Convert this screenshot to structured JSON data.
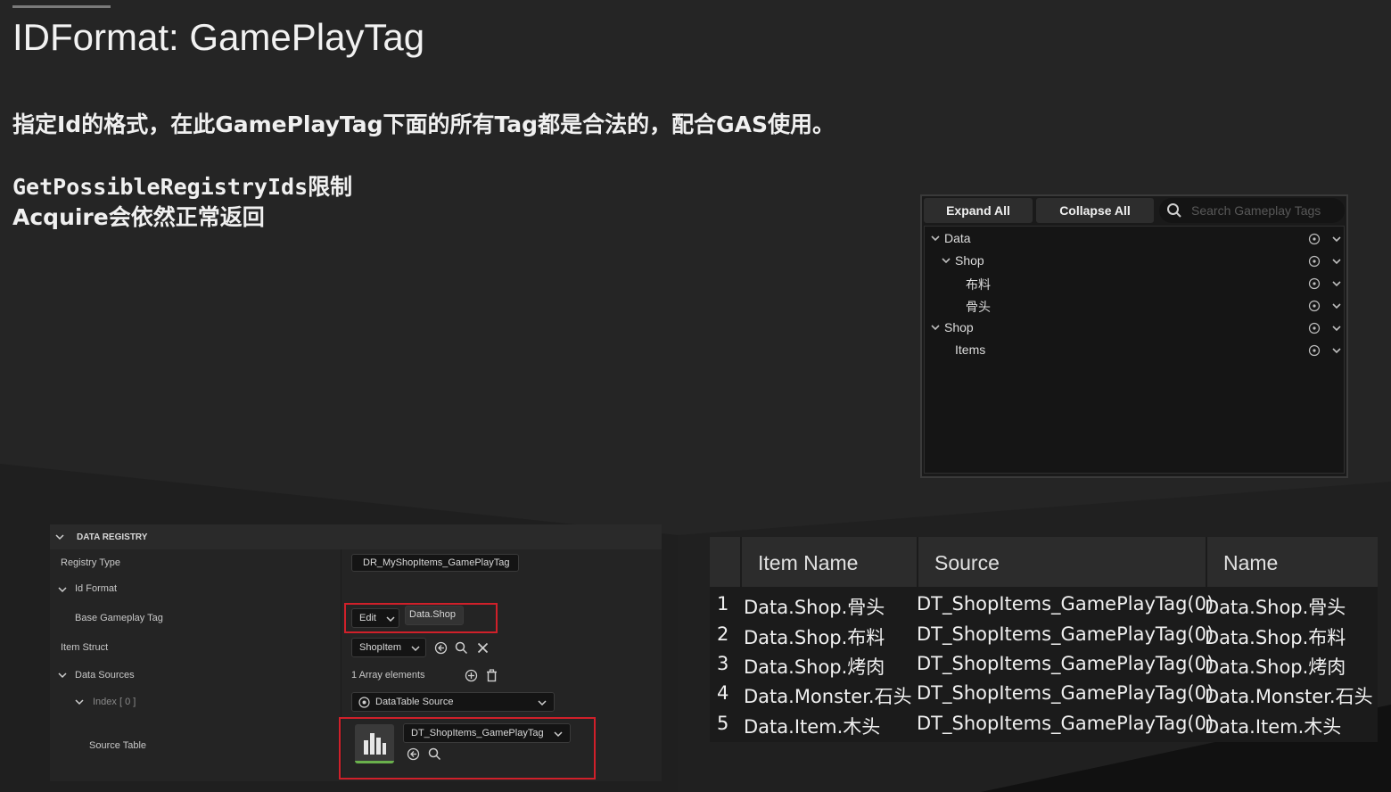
{
  "slide": {
    "title": "IDFormat: GamePlayTag",
    "subtitle": "指定Id的格式，在此GamePlayTag下面的所有Tag都是合法的，配合GAS使用。",
    "note_line1": "GetPossibleRegistryIds限制",
    "note_line2": "Acquire会依然正常返回"
  },
  "tag_picker": {
    "expand_all": "Expand All",
    "collapse_all": "Collapse All",
    "search_placeholder": "Search Gameplay Tags",
    "items": [
      {
        "label": "Data",
        "expanded": true,
        "has_chevron": true
      },
      {
        "label": "Shop",
        "expanded": true,
        "has_chevron": true
      },
      {
        "label": "布料",
        "expanded": false,
        "has_chevron": false
      },
      {
        "label": "骨头",
        "expanded": false,
        "has_chevron": false
      },
      {
        "label": "Shop",
        "expanded": true,
        "has_chevron": true
      },
      {
        "label": "Items",
        "expanded": false,
        "has_chevron": false
      }
    ]
  },
  "data_registry": {
    "section_title": "DATA REGISTRY",
    "registry_type_label": "Registry Type",
    "registry_type_value": "DR_MyShopItems_GamePlayTag",
    "id_format_label": "Id Format",
    "base_tag_label": "Base Gameplay Tag",
    "edit_label": "Edit",
    "base_tag_value": "Data.Shop",
    "item_struct_label": "Item Struct",
    "item_struct_value": "ShopItem",
    "data_sources_label": "Data Sources",
    "array_elements": "1 Array elements",
    "index_label": "Index [ 0 ]",
    "source_type": "DataTable Source",
    "source_table_label": "Source Table",
    "source_table_value": "DT_ShopItems_GamePlayTag"
  },
  "results_table": {
    "headers": [
      "Item Name",
      "Source",
      "Name"
    ],
    "rows": [
      {
        "idx": "1",
        "item_name": "Data.Shop.骨头",
        "source": "DT_ShopItems_GamePlayTag(0)",
        "name": "Data.Shop.骨头"
      },
      {
        "idx": "2",
        "item_name": "Data.Shop.布料",
        "source": "DT_ShopItems_GamePlayTag(0)",
        "name": "Data.Shop.布料"
      },
      {
        "idx": "3",
        "item_name": "Data.Shop.烤肉",
        "source": "DT_ShopItems_GamePlayTag(0)",
        "name": "Data.Shop.烤肉"
      },
      {
        "idx": "4",
        "item_name": "Data.Monster.石头",
        "source": "DT_ShopItems_GamePlayTag(0)",
        "name": "Data.Monster.石头"
      },
      {
        "idx": "5",
        "item_name": "Data.Item.木头",
        "source": "DT_ShopItems_GamePlayTag(0)",
        "name": "Data.Item.木头"
      }
    ]
  },
  "colors": {
    "highlight_border": "#d0202a",
    "background": "#252525"
  }
}
